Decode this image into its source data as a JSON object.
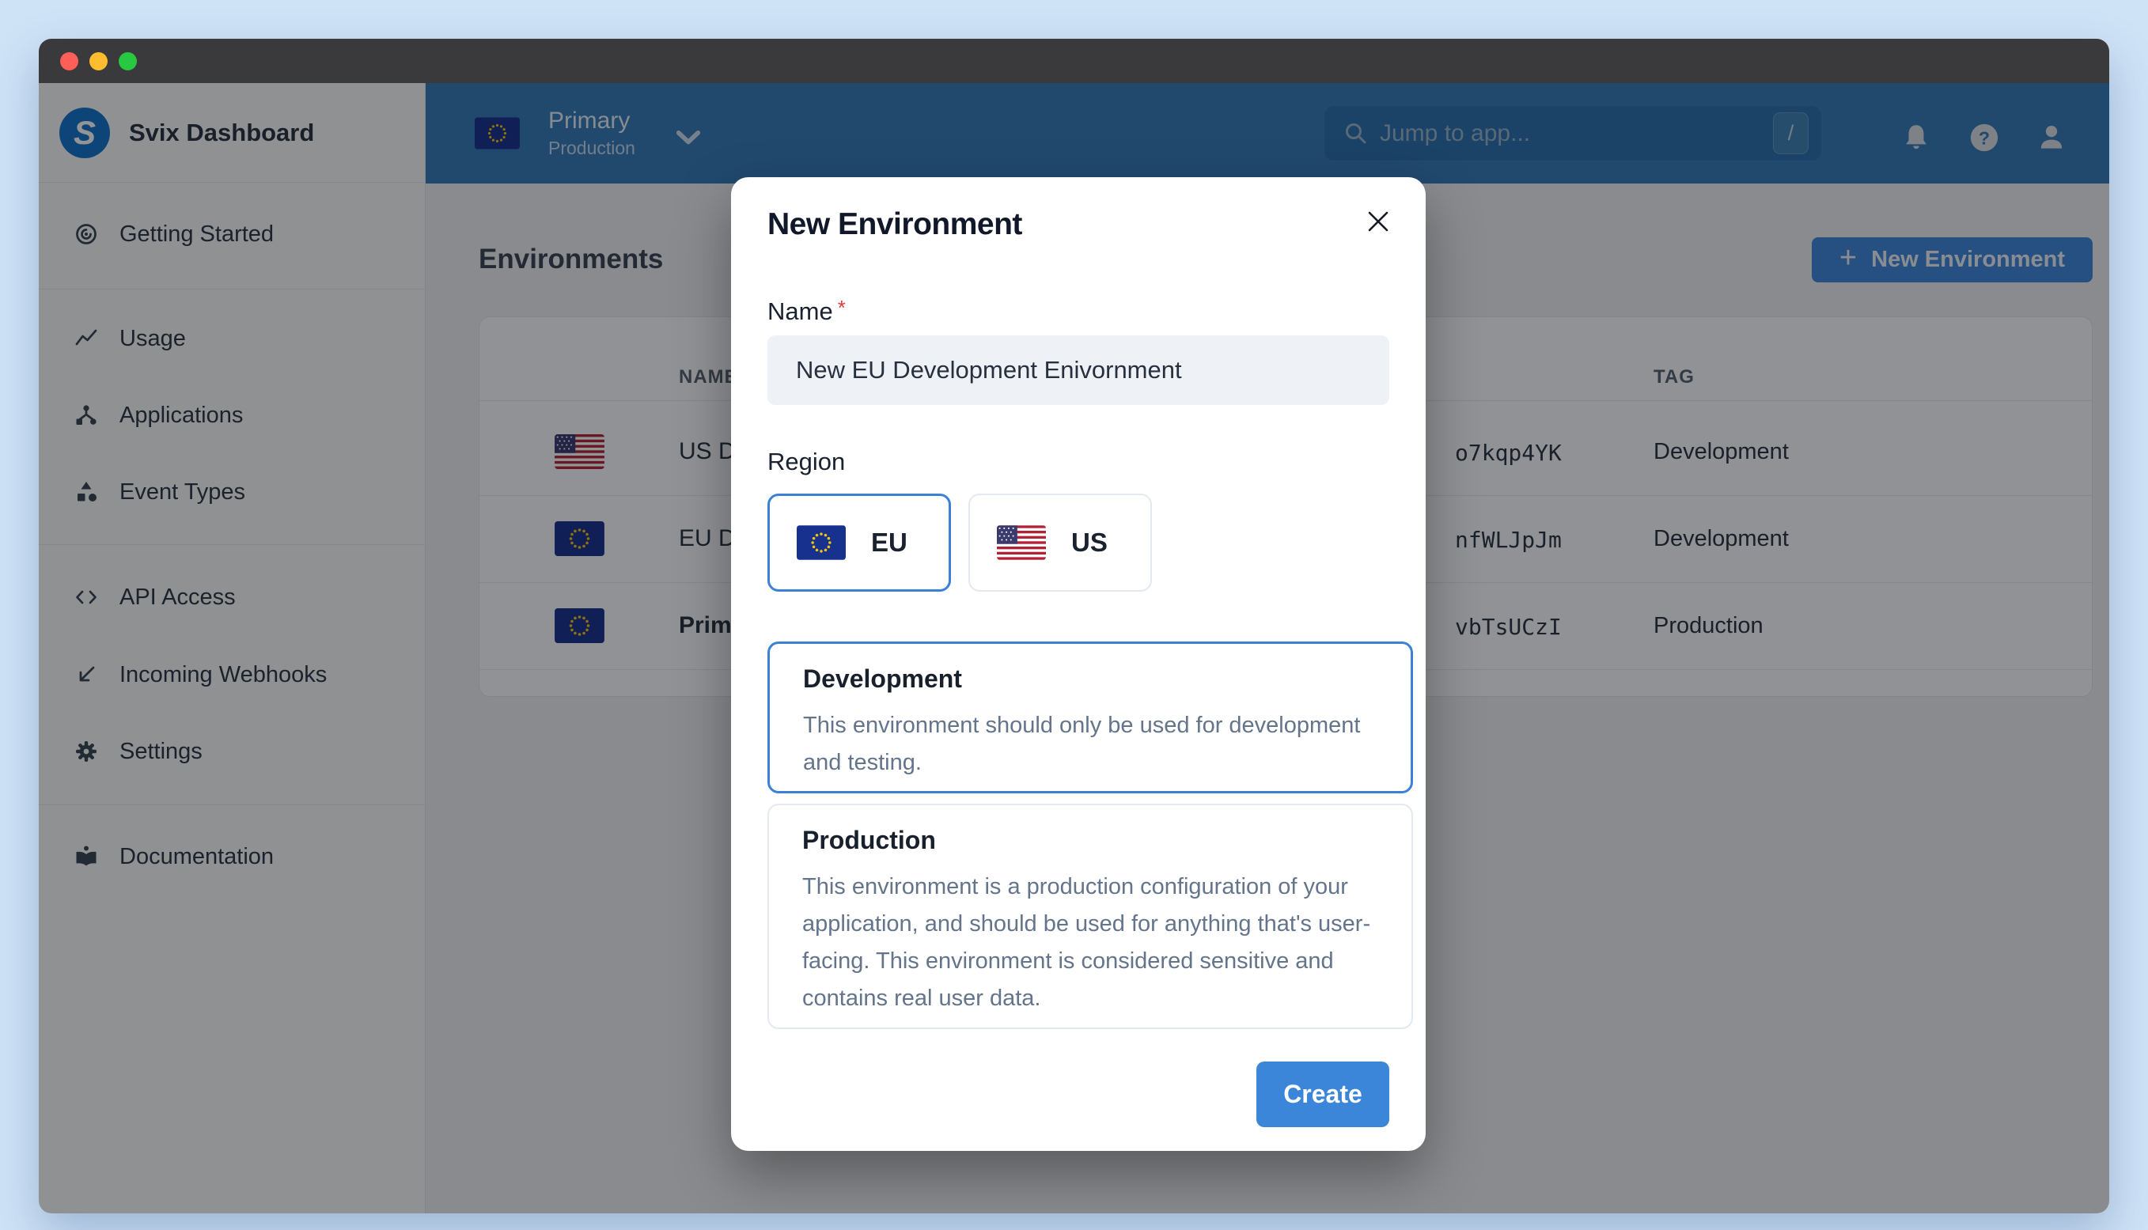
{
  "window": {
    "traffic_lights": [
      "close",
      "minimize",
      "zoom"
    ]
  },
  "sidebar": {
    "title": "Svix Dashboard",
    "logo_letter": "S",
    "groups": [
      {
        "items": [
          {
            "label": "Getting Started",
            "icon": "getting-started-icon"
          }
        ]
      },
      {
        "items": [
          {
            "label": "Usage",
            "icon": "usage-icon"
          },
          {
            "label": "Applications",
            "icon": "applications-icon"
          },
          {
            "label": "Event Types",
            "icon": "event-types-icon"
          }
        ]
      },
      {
        "items": [
          {
            "label": "API Access",
            "icon": "api-access-icon"
          },
          {
            "label": "Incoming Webhooks",
            "icon": "incoming-webhooks-icon"
          },
          {
            "label": "Settings",
            "icon": "settings-icon"
          }
        ]
      },
      {
        "items": [
          {
            "label": "Documentation",
            "icon": "documentation-icon"
          }
        ]
      }
    ]
  },
  "topbar": {
    "environment_switcher": {
      "name": "Primary",
      "tag": "Production",
      "flag": "eu"
    },
    "search": {
      "placeholder": "Jump to app...",
      "shortcut_key": "/"
    },
    "icons": [
      "moon-icon",
      "bell-icon",
      "help-icon",
      "user-icon"
    ]
  },
  "content": {
    "heading": "Environments",
    "new_environment_button": {
      "plus": "+",
      "label": "New Environment"
    },
    "table": {
      "columns": {
        "name": "NAME",
        "tag": "TAG"
      },
      "rows": [
        {
          "flag": "us",
          "name_visible": "US D",
          "id_visible": "o7kqp4YK",
          "tag": "Development",
          "active": false
        },
        {
          "flag": "eu",
          "name_visible": "EU D",
          "id_visible": "nfWLJpJm",
          "tag": "Development",
          "active": false
        },
        {
          "flag": "eu",
          "name_visible": "Prim",
          "id_visible": "vbTsUCzI",
          "tag": "Production",
          "active": true
        }
      ]
    }
  },
  "modal": {
    "title": "New Environment",
    "name_label": "Name",
    "required_asterisk": "*",
    "name_value": "New EU Development Enivornment",
    "region_label": "Region",
    "region_options": [
      {
        "label": "EU",
        "flag": "eu",
        "selected": true
      },
      {
        "label": "US",
        "flag": "us",
        "selected": false
      }
    ],
    "type_options": [
      {
        "title": "Development",
        "description": "This environment should only be used for development and testing.",
        "selected": true
      },
      {
        "title": "Production",
        "description": "This environment is a production configuration of your application, and should be used for anything that's user-facing. This environment is considered sensitive and contains real user data.",
        "selected": false
      }
    ],
    "create_label": "Create"
  },
  "colors": {
    "page_background": "#cfe3f7",
    "titlebar": "#3a3a3c",
    "topbar_blue": "#3579b8",
    "accent_blue": "#3b86d9",
    "selected_border_blue": "#3b82d6",
    "sidebar_background": "#f8f9fa",
    "input_background": "#eef1f6",
    "required_red": "#e23b3b",
    "eu_flag_blue": "#17318f",
    "us_flag_red": "#b22234",
    "dim_overlay": "rgba(10,12,16,0.44)"
  }
}
